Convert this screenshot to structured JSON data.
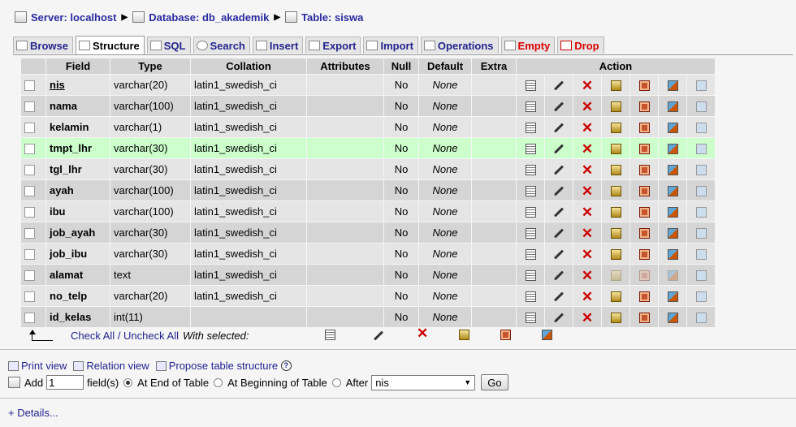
{
  "breadcrumb": {
    "server": "Server: localhost",
    "database": "Database: db_akademik",
    "table": "Table: siswa",
    "sep": "▶"
  },
  "tabs": [
    "Browse",
    "Structure",
    "SQL",
    "Search",
    "Insert",
    "Export",
    "Import",
    "Operations",
    "Empty",
    "Drop"
  ],
  "columns": [
    "Field",
    "Type",
    "Collation",
    "Attributes",
    "Null",
    "Default",
    "Extra",
    "Action"
  ],
  "rows": [
    {
      "field": "nis",
      "type": "varchar(20)",
      "collation": "latin1_swedish_ci",
      "attributes": "",
      "null": "No",
      "default": "None",
      "extra": ""
    },
    {
      "field": "nama",
      "type": "varchar(100)",
      "collation": "latin1_swedish_ci",
      "attributes": "",
      "null": "No",
      "default": "None",
      "extra": ""
    },
    {
      "field": "kelamin",
      "type": "varchar(1)",
      "collation": "latin1_swedish_ci",
      "attributes": "",
      "null": "No",
      "default": "None",
      "extra": ""
    },
    {
      "field": "tmpt_lhr",
      "type": "varchar(30)",
      "collation": "latin1_swedish_ci",
      "attributes": "",
      "null": "No",
      "default": "None",
      "extra": ""
    },
    {
      "field": "tgl_lhr",
      "type": "varchar(30)",
      "collation": "latin1_swedish_ci",
      "attributes": "",
      "null": "No",
      "default": "None",
      "extra": ""
    },
    {
      "field": "ayah",
      "type": "varchar(100)",
      "collation": "latin1_swedish_ci",
      "attributes": "",
      "null": "No",
      "default": "None",
      "extra": ""
    },
    {
      "field": "ibu",
      "type": "varchar(100)",
      "collation": "latin1_swedish_ci",
      "attributes": "",
      "null": "No",
      "default": "None",
      "extra": ""
    },
    {
      "field": "job_ayah",
      "type": "varchar(30)",
      "collation": "latin1_swedish_ci",
      "attributes": "",
      "null": "No",
      "default": "None",
      "extra": ""
    },
    {
      "field": "job_ibu",
      "type": "varchar(30)",
      "collation": "latin1_swedish_ci",
      "attributes": "",
      "null": "No",
      "default": "None",
      "extra": ""
    },
    {
      "field": "alamat",
      "type": "text",
      "collation": "latin1_swedish_ci",
      "attributes": "",
      "null": "No",
      "default": "None",
      "extra": ""
    },
    {
      "field": "no_telp",
      "type": "varchar(20)",
      "collation": "latin1_swedish_ci",
      "attributes": "",
      "null": "No",
      "default": "None",
      "extra": ""
    },
    {
      "field": "id_kelas",
      "type": "int(11)",
      "collation": "",
      "attributes": "",
      "null": "No",
      "default": "None",
      "extra": ""
    }
  ],
  "check": {
    "check_all": "Check All",
    "slash": " / ",
    "uncheck_all": "Uncheck All",
    "with_selected": "With selected:"
  },
  "links": {
    "print_view": "Print view",
    "relation_view": "Relation view",
    "propose": "Propose table structure"
  },
  "add": {
    "add_label": "Add",
    "count": "1",
    "fields_label": "field(s)",
    "end": "At End of Table",
    "beginning": "At Beginning of Table",
    "after": "After",
    "after_value": "nis",
    "go": "Go"
  },
  "details": "+ Details..."
}
